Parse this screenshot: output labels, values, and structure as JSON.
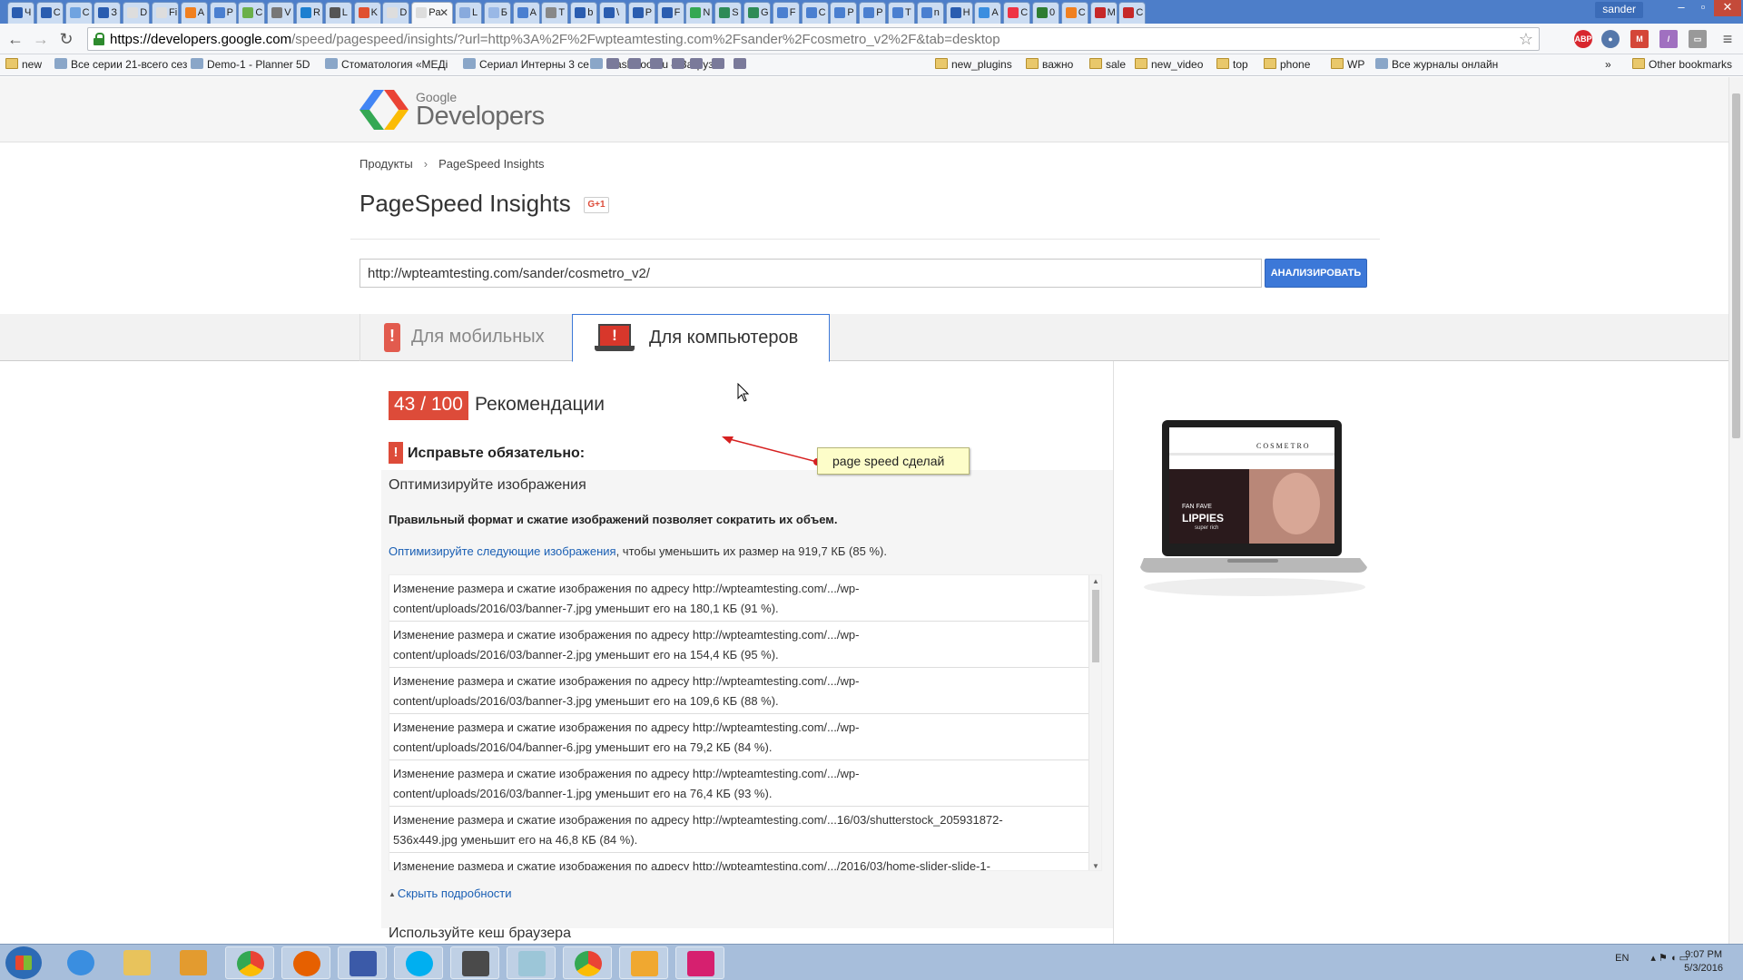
{
  "browser": {
    "profile_name": "sander",
    "active_tab_label": "Pa",
    "tabs": [
      "Ч",
      "С",
      "С",
      "З",
      "D",
      "Fi",
      "A",
      "P",
      "C",
      "V",
      "R",
      "L",
      "K",
      "D",
      "Pa",
      "L",
      "Б",
      "A",
      "Т",
      "b",
      "\\",
      "P",
      "F",
      "N",
      "S",
      "G",
      "F",
      "C",
      "P",
      "P",
      "T",
      "n",
      "Н",
      "A",
      "C",
      "0",
      "C",
      "M",
      "C"
    ],
    "url_host": "https://developers.google.com",
    "url_rest": "/speed/pagespeed/insights/?url=http%3A%2F%2Fwpteamtesting.com%2Fsander%2Fcosmetro_v2%2F&tab=desktop"
  },
  "bookmarks": [
    "new",
    "Все серии 21-всего сез",
    "Demo-1 - Planner 5D",
    "Стоматология «МЕДі",
    "Сериал Интерны 3 се",
    "FlashBoot.ru – Загруз",
    "new_plugins",
    "важно",
    "sale",
    "new_video",
    "top",
    "phone",
    "WP",
    "Все журналы онлайн",
    "»",
    "Other bookmarks"
  ],
  "header": {
    "logo_google": "Google",
    "logo_developers": "Developers"
  },
  "breadcrumb": {
    "products": "Продукты",
    "separator": "›",
    "current": "PageSpeed Insights"
  },
  "page": {
    "title": "PageSpeed Insights",
    "gplus": "G+1",
    "url_value": "http://wpteamtesting.com/sander/cosmetro_v2/",
    "analyze_label": "АНАЛИЗИРОВАТЬ"
  },
  "tabs": {
    "mobile": "Для мобильных",
    "desktop": "Для компьютеров"
  },
  "result": {
    "score": "43 / 100",
    "score_label": "Рекомендации",
    "must_fix": "Исправьте обязательно:",
    "rule_title": "Оптимизируйте изображения",
    "rule_desc": "Правильный формат и сжатие изображений позволяет сократить их объем.",
    "link_text": "Оптимизируйте следующие изображения",
    "link_suffix": ", чтобы уменьшить их размер на 919,7 КБ (85 %).",
    "items": [
      {
        "l1": "Изменение размера и сжатие изображения по адресу http://wpteamtesting.com/.../wp-",
        "l2": "content/uploads/2016/03/banner-7.jpg уменьшит его на 180,1 КБ (91 %)."
      },
      {
        "l1": "Изменение размера и сжатие изображения по адресу http://wpteamtesting.com/.../wp-",
        "l2": "content/uploads/2016/03/banner-2.jpg уменьшит его на 154,4 КБ (95 %)."
      },
      {
        "l1": "Изменение размера и сжатие изображения по адресу http://wpteamtesting.com/.../wp-",
        "l2": "content/uploads/2016/03/banner-3.jpg уменьшит его на 109,6 КБ (88 %)."
      },
      {
        "l1": "Изменение размера и сжатие изображения по адресу http://wpteamtesting.com/.../wp-",
        "l2": "content/uploads/2016/04/banner-6.jpg уменьшит его на 79,2 КБ (84 %)."
      },
      {
        "l1": "Изменение размера и сжатие изображения по адресу http://wpteamtesting.com/.../wp-",
        "l2": "content/uploads/2016/03/banner-1.jpg уменьшит его на 76,4 КБ (93 %)."
      },
      {
        "l1": "Изменение размера и сжатие изображения по адресу http://wpteamtesting.com/...16/03/shutterstock_205931872-",
        "l2": "536x449.jpg уменьшит его на 46,8 КБ (84 %)."
      },
      {
        "l1": "Изменение размера и сжатие изображения по адресу http://wpteamtesting.com/.../2016/03/home-slider-slide-1-",
        "l2": ""
      }
    ],
    "hide_details": "Скрыть подробности",
    "next_rule": "Используйте кеш браузера"
  },
  "annotation": {
    "note": "page speed сделай"
  },
  "screenshot_preview": {
    "brand": "COSMETRO",
    "banner_line1": "FAN FAVE",
    "banner_line2": "LIPPIES",
    "banner_line3": "super rich"
  },
  "taskbar": {
    "lang": "EN",
    "time": "9:07 PM",
    "date": "5/3/2016"
  },
  "colors": {
    "score_red": "#dd4b39",
    "link_blue": "#1a5fb4",
    "button_blue": "#3c78d8"
  }
}
